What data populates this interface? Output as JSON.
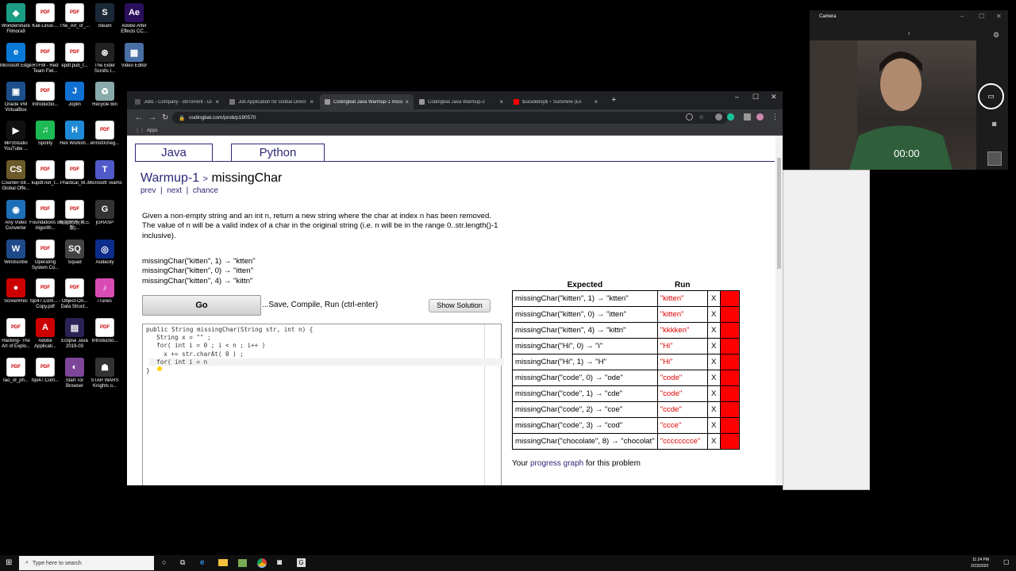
{
  "desktop_icons": [
    {
      "label": "Wondershare Filmora9",
      "glyph": "◆",
      "color": "#1b9c85"
    },
    {
      "label": "Kali-Linux-...",
      "glyph": "PDF",
      "color": "pdf"
    },
    {
      "label": "The_Art_of_...",
      "glyph": "PDF",
      "color": "pdf"
    },
    {
      "label": "Steam",
      "glyph": "S",
      "color": "#1b2838"
    },
    {
      "label": "Adobe After Effects CC...",
      "glyph": "Ae",
      "color": "#2a0f5c"
    },
    {
      "label": "Microsoft Edge",
      "glyph": "e",
      "color": "#0a78d7"
    },
    {
      "label": "RTFM - Red Team Fiel...",
      "glyph": "PDF",
      "color": "pdf"
    },
    {
      "label": "epdf.pub_t...",
      "glyph": "PDF",
      "color": "pdf"
    },
    {
      "label": "The Elder Scrolls I...",
      "glyph": "⊛",
      "color": "#222"
    },
    {
      "label": "Video Editor",
      "glyph": "▦",
      "color": "#4a6fa5"
    },
    {
      "label": "Oracle VM VirtualBox",
      "glyph": "▣",
      "color": "#1c4e8c"
    },
    {
      "label": "Introductio...",
      "glyph": "PDF",
      "color": "pdf"
    },
    {
      "label": "Joplin",
      "glyph": "J",
      "color": "#1071d3"
    },
    {
      "label": "Recycle Bin",
      "glyph": "♻",
      "color": "#8aa"
    },
    {
      "label": "MP3Studio YouTube ...",
      "glyph": "▶",
      "color": "#111"
    },
    {
      "label": "Spotify",
      "glyph": "♫",
      "color": "#1db954"
    },
    {
      "label": "Hex Worksh...",
      "glyph": "H",
      "color": "#1e8ad6"
    },
    {
      "label": "ermst0cheg...",
      "glyph": "PDF",
      "color": "pdf"
    },
    {
      "label": "Counter-Str... Global Offe...",
      "glyph": "CS",
      "color": "#6b5a2a"
    },
    {
      "label": "kupdf.net_t...",
      "glyph": "PDF",
      "color": "pdf"
    },
    {
      "label": "Practical_M...",
      "glyph": "PDF",
      "color": "pdf"
    },
    {
      "label": "Microsoft Teams",
      "glyph": "T",
      "color": "#5059c9"
    },
    {
      "label": "Any Video Converter",
      "glyph": "◉",
      "color": "#1d6fb8"
    },
    {
      "label": "Foundations of Algorith...",
      "glyph": "PDF",
      "color": "pdf"
    },
    {
      "label": "電腦網路(第三版)...",
      "glyph": "PDF",
      "color": "pdf"
    },
    {
      "label": "jGRASP",
      "glyph": "G",
      "color": "#333"
    },
    {
      "label": "Windscribe",
      "glyph": "W",
      "color": "#1f4a8a"
    },
    {
      "label": "Operating System Co...",
      "glyph": "PDF",
      "color": "pdf"
    },
    {
      "label": "Squad",
      "glyph": "SQ",
      "color": "#444"
    },
    {
      "label": "Audacity",
      "glyph": "◎",
      "color": "#0c2d8c"
    },
    {
      "label": "ScreenRec",
      "glyph": "●",
      "color": "#c00"
    },
    {
      "label": "fqo47.Com... - Copy.pdf",
      "glyph": "PDF",
      "color": "pdf"
    },
    {
      "label": "Object-Ori... Data Struct...",
      "glyph": "PDF",
      "color": "pdf"
    },
    {
      "label": "iTunes",
      "glyph": "♪",
      "color": "#d94cb4"
    },
    {
      "label": "Hacking- The Art of Explo...",
      "glyph": "PDF",
      "color": "pdf"
    },
    {
      "label": "Adobe Applicati...",
      "glyph": "A",
      "color": "#c00"
    },
    {
      "label": "Eclipse Java 2019-03",
      "glyph": "▤",
      "color": "#2c2255"
    },
    {
      "label": "Introductio...",
      "glyph": "PDF",
      "color": "pdf"
    },
    {
      "label": "tao_of_ph...",
      "glyph": "PDF",
      "color": "pdf"
    },
    {
      "label": "fqo47.Com...",
      "glyph": "PDF",
      "color": "pdf"
    },
    {
      "label": "Start Tor Browser",
      "glyph": "◐",
      "color": "#7d4698"
    },
    {
      "label": "STAR WARS Knights o...",
      "glyph": "☗",
      "color": "#333"
    }
  ],
  "browser": {
    "tabs": [
      {
        "title": "Jobs - Company - BitTorrent - Di",
        "fav": "#555"
      },
      {
        "title": "Job Application for Global Direct",
        "fav": "#777"
      },
      {
        "title": "CodingBat Java Warmup-1 missi",
        "fav": "#999",
        "active": true
      },
      {
        "title": "CodingBat Java Warmup-2",
        "fav": "#999"
      },
      {
        "title": "$uicideboy$ ~ Sunshine (Ex",
        "fav": "#f00"
      }
    ],
    "url": "codingbat.com/prob/p190570",
    "bookmarks_label": "Apps",
    "window_controls": [
      "–",
      "☐",
      "✕"
    ]
  },
  "page": {
    "lang_tabs": [
      "Java",
      "Python"
    ],
    "breadcrumb_section": "Warmup-1",
    "breadcrumb_sep": ">",
    "problem_name": "missingChar",
    "nav": {
      "prev": "prev",
      "next": "next",
      "chance": "chance",
      "sep": "|"
    },
    "description": "Given a non-empty string and an int n, return a new string where the char at index n has been removed. The value of n will be a valid index of a char in the original string (i.e. n will be in the range 0..str.length()-1 inclusive).",
    "examples": [
      "missingChar(\"kitten\", 1) → \"ktten\"",
      "missingChar(\"kitten\", 0) → \"itten\"",
      "missingChar(\"kitten\", 4) → \"kittn\""
    ],
    "go_label": "Go",
    "save_hint": "...Save, Compile, Run (ctrl-enter)",
    "show_solution_label": "Show Solution",
    "code_lines": [
      "public String missingChar(String str, int n) {",
      "  String x = \"\" ;",
      "  for( int i = 0 ; i < n ; i++ )",
      "    x += str.charAt( 0 ) ;",
      "  for( int i = n",
      "}"
    ],
    "results_headers": {
      "expected": "Expected",
      "run": "Run"
    },
    "results": [
      {
        "expected": "missingChar(\"kitten\", 1) → \"ktten\"",
        "run": "\"kitten\"",
        "mark": "X"
      },
      {
        "expected": "missingChar(\"kitten\", 0) → \"itten\"",
        "run": "\"kitten\"",
        "mark": "X"
      },
      {
        "expected": "missingChar(\"kitten\", 4) → \"kittn\"",
        "run": "\"kkkken\"",
        "mark": "X"
      },
      {
        "expected": "missingChar(\"Hi\", 0) → \"i\"",
        "run": "\"Hi\"",
        "mark": "X"
      },
      {
        "expected": "missingChar(\"Hi\", 1) → \"H\"",
        "run": "\"Hi\"",
        "mark": "X"
      },
      {
        "expected": "missingChar(\"code\", 0) → \"ode\"",
        "run": "\"code\"",
        "mark": "X"
      },
      {
        "expected": "missingChar(\"code\", 1) → \"cde\"",
        "run": "\"code\"",
        "mark": "X"
      },
      {
        "expected": "missingChar(\"code\", 2) → \"coe\"",
        "run": "\"ccde\"",
        "mark": "X"
      },
      {
        "expected": "missingChar(\"code\", 3) → \"cod\"",
        "run": "\"ccce\"",
        "mark": "X"
      },
      {
        "expected": "missingChar(\"chocolate\", 8) → \"chocolat\"",
        "run": "\"cccccccce\"",
        "mark": "X"
      }
    ],
    "progress_prefix": "Your ",
    "progress_link": "progress graph",
    "progress_suffix": " for this problem"
  },
  "camera": {
    "title": "Camera",
    "timer": "00:00"
  },
  "taskbar": {
    "search_placeholder": "Type here to search",
    "time": "11:24 PM",
    "date": "2/23/2020"
  },
  "colors": {
    "codingbat_blue": "#2b2875",
    "fail_red": "#ff0000",
    "run_text_red": "#dd0000"
  }
}
